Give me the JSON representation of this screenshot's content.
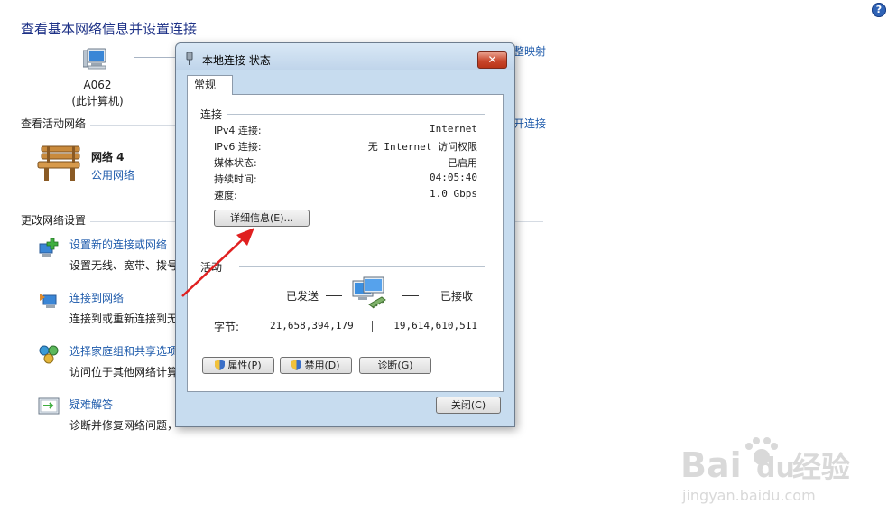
{
  "background": {
    "title": "查看基本网络信息并设置连接",
    "computer_name": "A062",
    "computer_sub": "(此计算机)",
    "partial_link_map": "整映射",
    "section_active": "查看活动网络",
    "partial_link_connect": "开连接",
    "network_name": "网络  4",
    "network_type": "公用网络",
    "section_change": "更改网络设置",
    "tasks": [
      {
        "title": "设置新的连接或网络",
        "desc": "设置无线、宽带、拨号"
      },
      {
        "title": "连接到网络",
        "desc": "连接到或重新连接到无"
      },
      {
        "title": "选择家庭组和共享选项",
        "desc": "访问位于其他网络计算"
      },
      {
        "title": "疑难解答",
        "desc": "诊断并修复网络问题，"
      }
    ]
  },
  "dialog": {
    "title": "本地连接 状态",
    "close_glyph": "✕",
    "tab": "常规",
    "group_connection": "连接",
    "rows": [
      {
        "label": "IPv4 连接:",
        "value": "Internet"
      },
      {
        "label": "IPv6 连接:",
        "value": "无 Internet 访问权限"
      },
      {
        "label": "媒体状态:",
        "value": "已启用"
      },
      {
        "label": "持续时间:",
        "value": "04:05:40"
      },
      {
        "label": "速度:",
        "value": "1.0 Gbps"
      }
    ],
    "details_button": "详细信息(E)...",
    "group_activity": "活动",
    "sent_label": "已发送",
    "received_label": "已接收",
    "bytes_label": "字节:",
    "bytes_sent": "21,658,394,179",
    "bytes_received": "19,614,610,511",
    "btn_properties": "属性(P)",
    "btn_disable": "禁用(D)",
    "btn_diagnose": "诊断(G)",
    "btn_close": "关闭(C)"
  },
  "help_glyph": "?",
  "watermark": {
    "brand": "Bai",
    "brand2": "du",
    "cn": "经验",
    "url": "jingyan.baidu.com"
  },
  "colors": {
    "link": "#1d5aab",
    "title": "#1e3287",
    "arrow": "#e02020"
  }
}
